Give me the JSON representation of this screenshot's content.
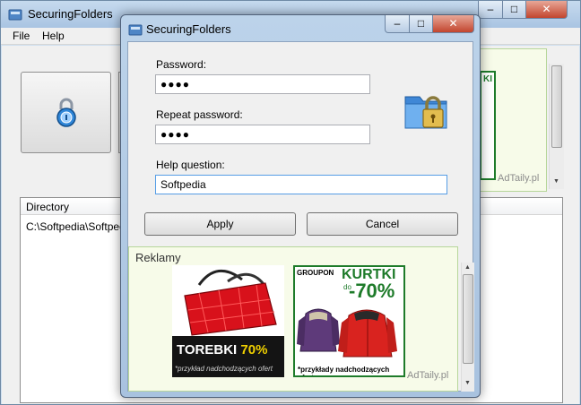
{
  "main_window": {
    "title": "SecuringFolders",
    "menu": [
      "File",
      "Help"
    ],
    "file_list": {
      "column_header": "Directory",
      "rows": [
        "C:\\Softpedia\\Softpedia"
      ]
    },
    "ad_fragment": {
      "text": "KI",
      "credit": "AdTaily.pl"
    }
  },
  "dialog": {
    "title": "SecuringFolders",
    "password_label": "Password:",
    "password_value": "●●●●",
    "repeat_label": "Repeat password:",
    "repeat_value": "●●●●",
    "help_label": "Help question:",
    "help_value": "Softpedia",
    "apply_label": "Apply",
    "cancel_label": "Cancel",
    "ads": {
      "title": "Reklamy",
      "left": {
        "headline": "TOREBKI",
        "percent": "70%",
        "note": "*przykład nadchodzących ofert"
      },
      "right": {
        "brand": "GROUPON",
        "headline": "KURTKI",
        "prefix": "do",
        "percent": "-70%",
        "note": "*przykłady nadchodzących ofert"
      },
      "credit": "AdTaily.pl"
    }
  },
  "colors": {
    "title_bar": "#b3cbe6",
    "close_button": "#c2452e",
    "ad_green": "#1e7b2a",
    "ad_bg": "#f7fbe9"
  }
}
